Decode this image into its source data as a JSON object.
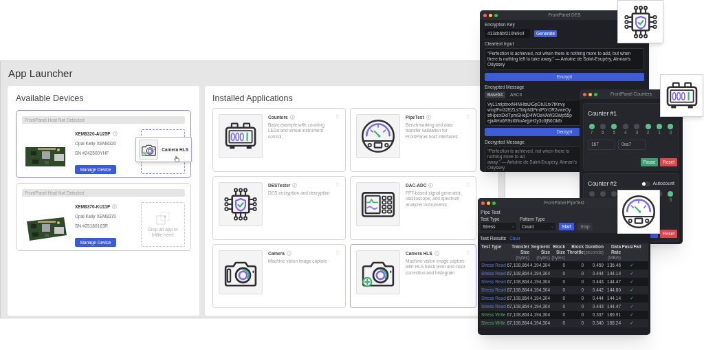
{
  "launcher": {
    "title": "App Launcher",
    "devices_heading": "Available Devices",
    "devices": [
      {
        "status": "FrontPanel Host Not Detected",
        "name": "XEM8320-AU25P",
        "model": "Opal Kelly XEM8320",
        "serial": "SN #242500YHF",
        "button": "Manage Device",
        "highlighted": true
      },
      {
        "status": "FrontPanel Host Not Detected",
        "name": "XEM8370-KU11P",
        "model": "Opal Kelly XEM8370",
        "serial": "SN #25180163R",
        "button": "Manage Device",
        "highlighted": false,
        "drop_hint": "Drop an app or bitfile here!"
      }
    ],
    "drag_ghost": {
      "label": "Camera HLS",
      "kind": "camera-plus"
    },
    "apps_heading": "Installed Applications",
    "apps": [
      {
        "name": "Counters",
        "description": "Basic example with counting LEDs and virtual instrument control.",
        "kind": "counter",
        "highlighted": false
      },
      {
        "name": "PipeTest",
        "description": "Benchmarking and data transfer validation for FrontPanel host interfaces",
        "kind": "gauge",
        "highlighted": false
      },
      {
        "name": "DESTester",
        "description": "DES encryption and decryption",
        "kind": "chip",
        "highlighted": false
      },
      {
        "name": "DAC-ADC",
        "description": "FFT-based signal generator, oscilloscope, and spectrum analyzer instruments",
        "kind": "scope",
        "highlighted": false
      },
      {
        "name": "Camera",
        "description": "Machine vision image capture",
        "kind": "camera",
        "highlighted": false
      },
      {
        "name": "Camera HLS",
        "description": "Machine vision image capture with HLS black level and color correction and histogram",
        "kind": "camera-plus",
        "highlighted": true
      }
    ]
  },
  "des_window": {
    "title": "FrontPanel DES",
    "key_label": "Encryption Key",
    "key_value": "413cb6bf210fe9c4",
    "generate": "Generate",
    "cleartext_label": "Cleartext Input",
    "cleartext": "“Perfection is achieved, not when there is nothing more to add, but when there is nothing left to take away.” — Antoine de Saint-Exupéry, Airman's Odyssey",
    "encrypt": "Encrypt",
    "encrypted_label": "Encrypted Message",
    "formats": [
      {
        "label": "Base64",
        "selected": true
      },
      {
        "label": "ASCII",
        "selected": false
      }
    ],
    "encrypted_lines": [
      "VyL1mipbxxN4NHtsUiGpDhJLtx7tKnvy",
      "wcqfFm32EZLsTMpN3PmIP0rOR2vweOy",
      "sfHpexDkITpmSHejD4WOaVAW3SWp55p",
      "ejaAHo6R9st6NoAejpH2y3c0jB6Okfb"
    ],
    "decrypt": "Decrypt",
    "decrypted_label": "Decrypted Message",
    "decrypted_lines": [
      "“Perfection is achieved, not when there is nothing more to ad",
      "away.” — Antoine de Saint-Exupéry, Airman's Odyssey"
    ]
  },
  "counters_window": {
    "title": "FrontPanel Counters",
    "counters": [
      {
        "title": "Counter #1",
        "leds": [
          {
            "label": "7",
            "on": true
          },
          {
            "label": "6",
            "on": false
          },
          {
            "label": "5",
            "on": true
          },
          {
            "label": "4",
            "on": false
          },
          {
            "label": "3",
            "on": false
          },
          {
            "label": "2",
            "on": true
          },
          {
            "label": "1",
            "on": true
          },
          {
            "label": "0",
            "on": true
          }
        ],
        "decimal": "167",
        "hex": "0xa7",
        "buttons": [
          {
            "label": "Pause",
            "kind": "pause"
          },
          {
            "label": "Reset",
            "kind": "reset"
          }
        ]
      },
      {
        "title": "Counter #2",
        "autocount": {
          "label": "Autocount",
          "on": false
        },
        "leds": [
          {
            "on": false
          },
          {
            "on": false
          },
          {
            "on": false
          },
          {
            "on": false
          },
          {
            "label": "0",
            "on": true
          }
        ],
        "buttons": [
          {
            "kind": "start"
          },
          {
            "label": "Reset",
            "kind": "reset"
          }
        ]
      }
    ]
  },
  "pipe_window": {
    "title": "FrontPanel PipeTest",
    "heading": "Pipe Test",
    "selects": [
      {
        "label": "Test Type",
        "value": "Stress"
      },
      {
        "label": "Pattern Type",
        "value": "Count"
      }
    ],
    "buttons": [
      {
        "label": "Start",
        "disabled": false
      },
      {
        "label": "Stop",
        "disabled": true
      }
    ],
    "results_heading": "Test Results",
    "clear": "Clear",
    "columns": [
      {
        "label": "Test Type"
      },
      {
        "label": "Transfer Size",
        "unit": "(bytes)"
      },
      {
        "label": "Segment Size",
        "unit": "(bytes)"
      },
      {
        "label": "Block Size",
        "unit": "(bytes)"
      },
      {
        "label": "Block Throttle"
      },
      {
        "label": "Duration",
        "unit": "(seconds)"
      },
      {
        "label": "Data Rate",
        "unit": "(MB/s)"
      },
      {
        "label": "Pass/Fail"
      }
    ],
    "rows": [
      {
        "kind": "read",
        "cells": [
          "Stress Read",
          "67,108,864",
          "4,194,304",
          "0",
          "0",
          "0.459",
          "136.46",
          "✓"
        ]
      },
      {
        "kind": "read",
        "cells": [
          "Stress Read",
          "67,108,864",
          "4,194,304",
          "0",
          "0",
          "0.444",
          "144.14",
          "✓"
        ]
      },
      {
        "kind": "read",
        "cells": [
          "Stress Read",
          "67,108,864",
          "4,194,304",
          "0",
          "0",
          "0.443",
          "144.47",
          "✓"
        ]
      },
      {
        "kind": "read",
        "cells": [
          "Stress Read",
          "67,108,864",
          "4,194,304",
          "0",
          "0",
          "0.442",
          "144.80",
          "✓"
        ]
      },
      {
        "kind": "read",
        "cells": [
          "Stress Read",
          "67,108,864",
          "4,194,304",
          "0",
          "0",
          "0.444",
          "144.14",
          "✓"
        ]
      },
      {
        "kind": "read",
        "cells": [
          "Stress Read",
          "67,108,864",
          "4,194,304",
          "0",
          "0",
          "0.443",
          "144.47",
          "✓"
        ]
      },
      {
        "kind": "write",
        "cells": [
          "Stress Write",
          "67,108,864",
          "4,194,304",
          "0",
          "0",
          "0.337",
          "189.91",
          "✓"
        ]
      },
      {
        "kind": "write",
        "cells": [
          "Stress Write",
          "67,108,864",
          "4,194,304",
          "0",
          "0",
          "0.340",
          "188.24",
          "✓"
        ]
      }
    ]
  },
  "floating_tiles": [
    {
      "kind": "chip"
    },
    {
      "kind": "counter"
    },
    {
      "kind": "gauge"
    }
  ]
}
